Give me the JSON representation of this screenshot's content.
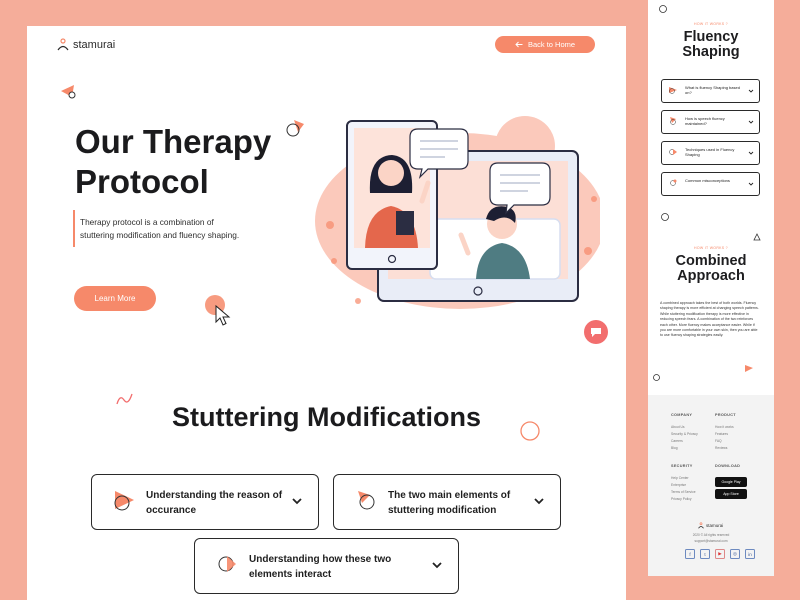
{
  "brand": {
    "name": "stamurai",
    "accent": "#f6896a",
    "background": "#f5ad9a"
  },
  "header": {
    "back_label": "Back to Home",
    "back_icon": "arrow-left-icon"
  },
  "hero": {
    "title_line1": "Our Therapy",
    "title_line2": "Protocol",
    "description": "Therapy protocol is a combination of stuttering modification and fluency shaping.",
    "cta_label": "Learn More"
  },
  "stuttering": {
    "title": "Stuttering Modifications",
    "items": [
      {
        "label": "Understanding the reason of occurance"
      },
      {
        "label": "The two main elements of stuttering modification"
      },
      {
        "label": "Understanding how these two elements interact"
      }
    ]
  },
  "side": {
    "fluency": {
      "overline": "HOW IT WORKS ?",
      "title_line1": "Fluency",
      "title_line2": "Shaping",
      "items": [
        {
          "label": "What is fluency Shaping based on?"
        },
        {
          "label": "How is speech fluency maintained?"
        },
        {
          "label": "Techniques used in Fluency Shaping"
        },
        {
          "label": "Common misconceptions"
        }
      ]
    },
    "combined": {
      "overline": "HOW IT WORKS ?",
      "title_line1": "Combined",
      "title_line2": "Approach",
      "paragraph": "A combined approach takes the best of both worlds. Fluency shaping therapy is more efficient at changing speech patterns. While stuttering modification therapy is more effective in reducing speech fears. A combination of the two reinforces each other. More fluency makes acceptance easier. While if you are more comfortable in your own skin, then you are able to use fluency shaping strategies easily."
    },
    "footer": {
      "company_head": "COMPANY",
      "company_links": [
        "About Us",
        "Security & Privacy",
        "Careers",
        "Blog"
      ],
      "product_head": "PRODUCT",
      "product_links": [
        "How it works",
        "Features",
        "FAQ",
        "Reviews"
      ],
      "security_head": "SECURITY",
      "security_links": [
        "Help Center",
        "Enterprise",
        "Terms of Service",
        "Privacy Policy"
      ],
      "download_head": "DOWNLOAD",
      "google_play": "Google Play",
      "app_store": "App Store",
      "brand": "stamurai",
      "copyright": "2020 © All rights reserved",
      "email": "support@stamurai.com"
    }
  }
}
